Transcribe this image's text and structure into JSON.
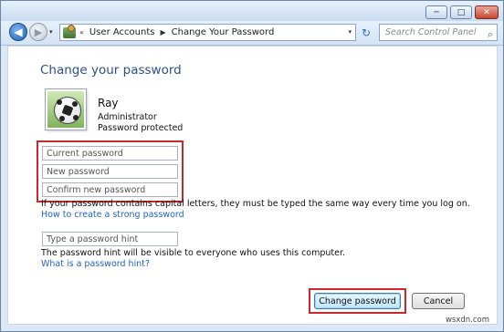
{
  "window": {
    "minimize_glyph": "─",
    "maximize_glyph": "□",
    "close_glyph": "✕"
  },
  "nav": {
    "back_icon": "◀",
    "forward_icon": "▶",
    "dropdown_icon": "▾",
    "breadcrumb": [
      "User Accounts",
      "Change Your Password"
    ],
    "refresh_icon": "↻",
    "search_placeholder": "Search Control Panel",
    "search_icon": "⌕"
  },
  "page": {
    "title": "Change your password",
    "user": {
      "name": "Ray",
      "role": "Administrator",
      "status": "Password protected"
    },
    "fields": {
      "current_password": "Current password",
      "new_password": "New password",
      "confirm_password": "Confirm new password",
      "hint": "Type a password hint"
    },
    "notes": {
      "capital_letters": "If your password contains capital letters, they must be typed the same way every time you log on.",
      "hint_visible": "The password hint will be visible to everyone who uses this computer."
    },
    "links": {
      "strong_password": "How to create a strong password",
      "what_is_hint": "What is a password hint?"
    },
    "buttons": {
      "change_password": "Change password",
      "cancel": "Cancel"
    }
  },
  "highlight_color": "#c8292b",
  "link_color": "#1f63c4",
  "watermark": "wsxdn.com"
}
